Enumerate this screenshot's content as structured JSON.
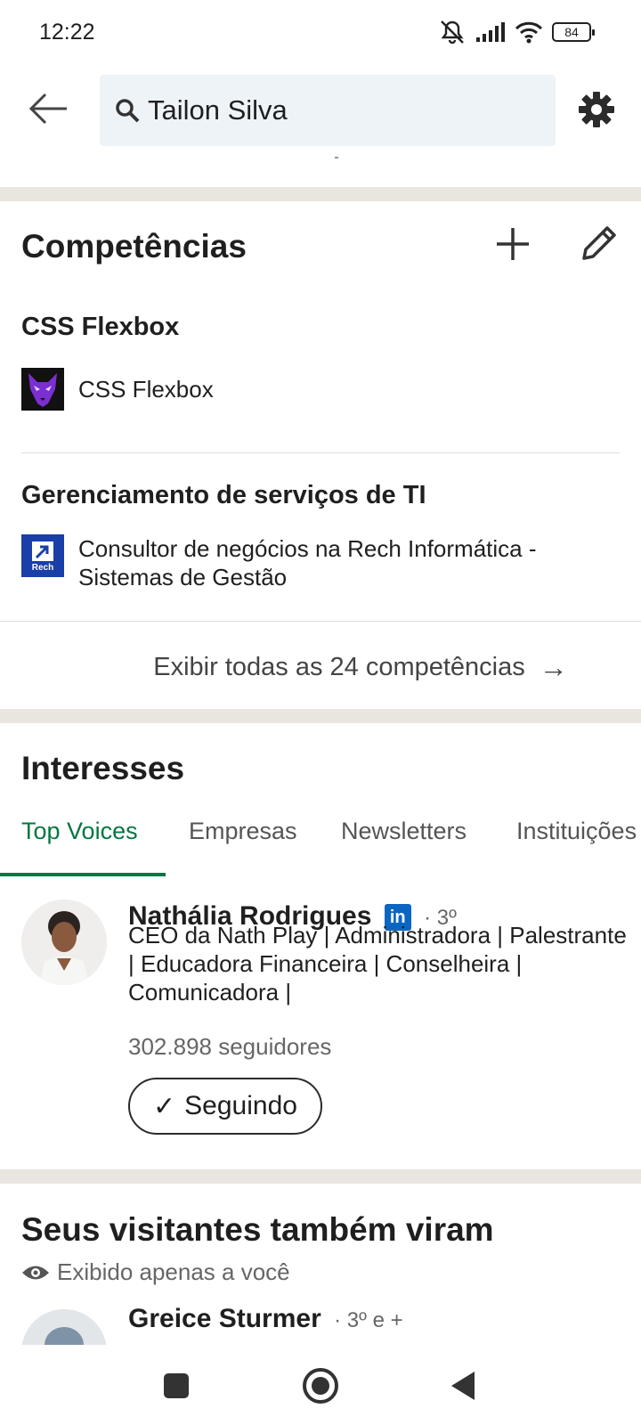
{
  "status_bar": {
    "time": "12:22",
    "battery": "84"
  },
  "search": {
    "query": "Tailon Silva"
  },
  "skills": {
    "title": "Competências",
    "items": [
      {
        "name": "CSS Flexbox",
        "association": "CSS Flexbox"
      },
      {
        "name": "Gerenciamento de serviços de TI",
        "association": "Consultor de negócios na Rech Informática - Sistemas de Gestão",
        "logo_text": "Rech"
      }
    ],
    "show_all": "Exibir todas as 24 competências"
  },
  "interests": {
    "title": "Interesses",
    "tabs": [
      "Top Voices",
      "Empresas",
      "Newsletters",
      "Instituições"
    ],
    "person": {
      "name": "Nathália Rodrigues",
      "badge": "in",
      "degree": "· 3º",
      "headline": "CEO da Nath Play | Administradora | Palestrante | Educadora Financeira | Conselheira | Comunicadora |",
      "followers": "302.898 seguidores",
      "button": "Seguindo"
    }
  },
  "visitors": {
    "title": "Seus visitantes também viram",
    "subtitle": "Exibido apenas a você",
    "person": {
      "name": "Greice Sturmer",
      "degree": "· 3º e +"
    }
  },
  "colors": {
    "accent": "#057642",
    "linkedin_blue": "#0a66c2",
    "band": "#e9e5df",
    "search_bg": "#eef3f8"
  }
}
